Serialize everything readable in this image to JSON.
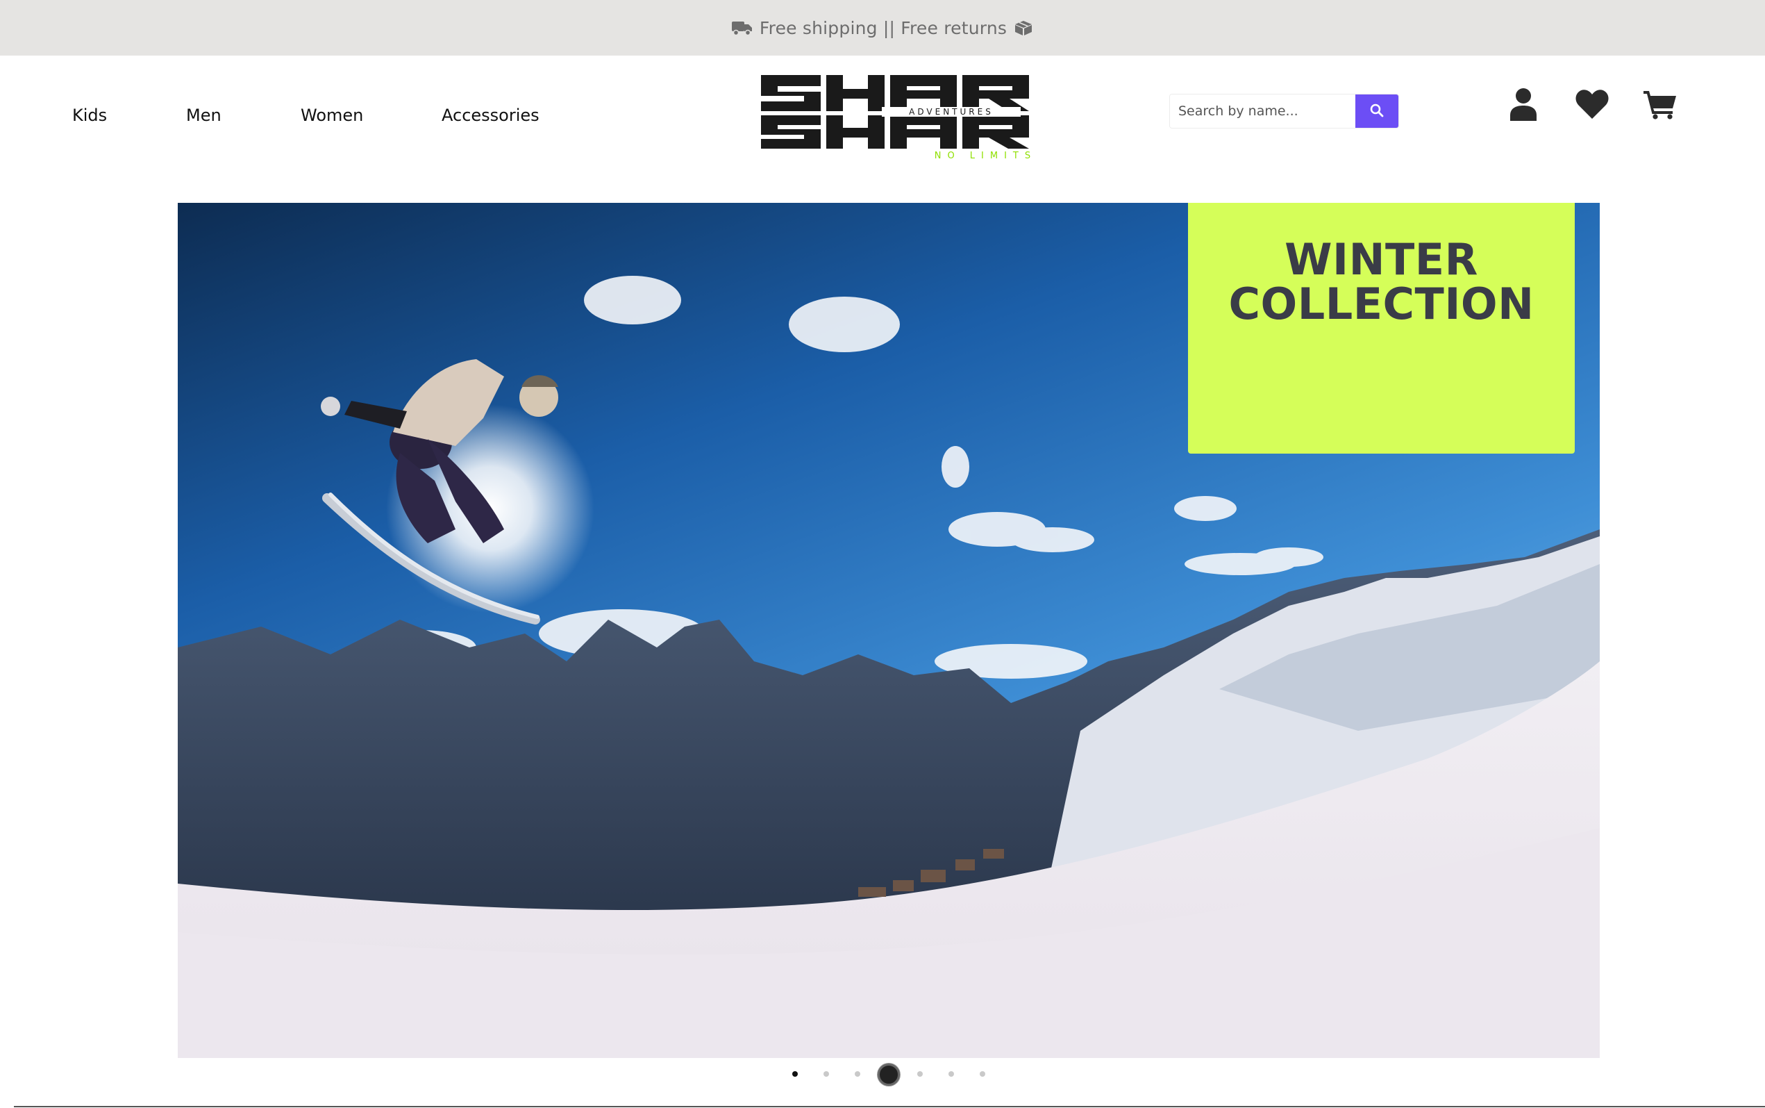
{
  "promo_bar": {
    "text": "Free shipping || Free returns",
    "left_icon": "truck-icon",
    "right_icon": "box-icon"
  },
  "nav": {
    "items": [
      {
        "label": "Kids"
      },
      {
        "label": "Men"
      },
      {
        "label": "Women"
      },
      {
        "label": "Accessories"
      }
    ]
  },
  "logo": {
    "brand": "SHAR",
    "sub": "ADVENTURES",
    "tagline": "NO LIMITS."
  },
  "search": {
    "placeholder": "Search by name...",
    "value": "",
    "button_icon": "search-icon"
  },
  "header_icons": [
    "user-icon",
    "heart-icon",
    "cart-icon"
  ],
  "hero": {
    "title_line1": "WINTER",
    "title_line2": "COLLECTION",
    "image": "snowboarder-jumping-mountains"
  },
  "carousel": {
    "slides": 7,
    "active_index": 3
  },
  "colors": {
    "accent": "#6c4ef5",
    "promo_box": "#d5fe59",
    "promo_bar_bg": "#e5e4e2",
    "title_text": "#3a3c47"
  }
}
